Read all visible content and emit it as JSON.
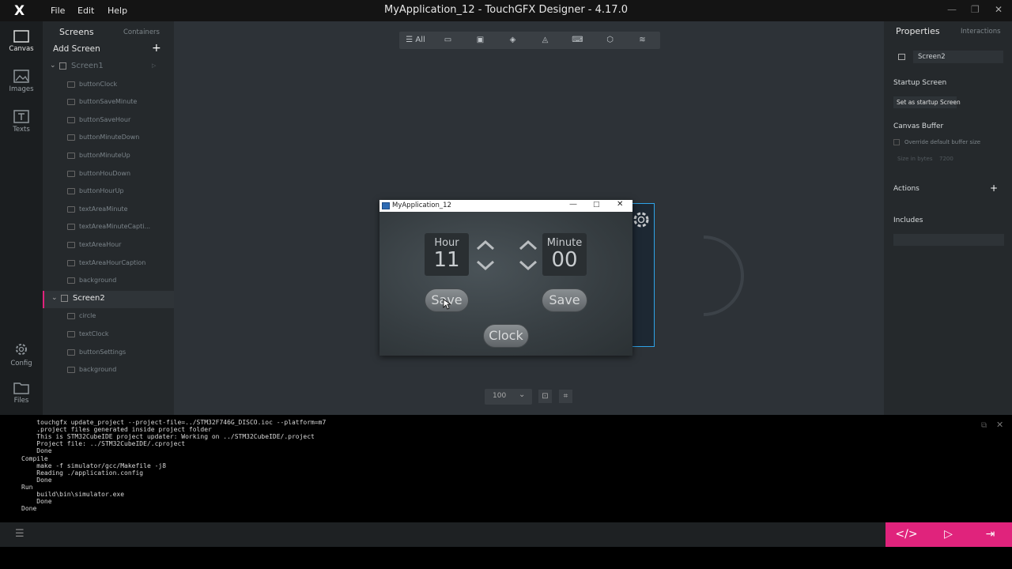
{
  "titlebar": {
    "logo": "X",
    "menu": [
      "File",
      "Edit",
      "Help"
    ],
    "title": "MyApplication_12 - TouchGFX Designer - 4.17.0"
  },
  "leftbar": {
    "items": [
      {
        "label": "Canvas",
        "icon": "canvas-icon"
      },
      {
        "label": "Images",
        "icon": "images-icon"
      },
      {
        "label": "Texts",
        "icon": "texts-icon"
      },
      {
        "label": "Config",
        "icon": "gear-icon"
      },
      {
        "label": "Files",
        "icon": "folder-icon"
      }
    ]
  },
  "screens_panel": {
    "tab_screens": "Screens",
    "tab_containers": "Containers",
    "add_screen": "Add Screen",
    "add_plus": "+",
    "screen1": {
      "name": "Screen1",
      "widgets": [
        "buttonClock",
        "buttonSaveMinute",
        "buttonSaveHour",
        "buttonMinuteDown",
        "buttonMinuteUp",
        "buttonHouDown",
        "buttonHourUp",
        "textAreaMinute",
        "textAreaMinuteCapti...",
        "textAreaHour",
        "textAreaHourCaption",
        "background"
      ]
    },
    "screen2": {
      "name": "Screen2",
      "widgets": [
        "circle",
        "textClock",
        "buttonSettings",
        "background"
      ]
    }
  },
  "toolbar": {
    "all_label": "All"
  },
  "zoom": {
    "value": "100"
  },
  "simulator": {
    "title": "MyApplication_12",
    "hour_caption": "Hour",
    "hour_value": "11",
    "minute_caption": "Minute",
    "minute_value": "00",
    "save_hour": "Save",
    "save_minute": "Save",
    "clock": "Clock"
  },
  "properties": {
    "tab_properties": "Properties",
    "tab_interactions": "Interactions",
    "screen_name": "Screen2",
    "startup_heading": "Startup Screen",
    "startup_button": "Set as startup Screen",
    "canvas_buffer_heading": "Canvas Buffer",
    "override_label": "Override default buffer size",
    "size_label": "Size in bytes",
    "size_value": "7200",
    "actions_heading": "Actions",
    "actions_plus": "+",
    "includes_heading": "Includes"
  },
  "console": {
    "lines": [
      "    touchgfx update_project --project-file=../STM32F746G_DISCO.ioc --platform=m7",
      "    .project files generated inside project folder",
      "    This is STM32CubeIDE project updater: Working on ../STM32CubeIDE/.project",
      "    Project file: ../STM32CubeIDE/.cproject",
      "    Done",
      "Compile",
      "    make -f simulator/gcc/Makefile -j8",
      "    Reading ./application.config",
      "    Done",
      "Run",
      "    build\\bin\\simulator.exe",
      "    Done",
      "Done"
    ]
  },
  "colors": {
    "accent": "#e0237c",
    "selection": "#2ea3e8"
  }
}
